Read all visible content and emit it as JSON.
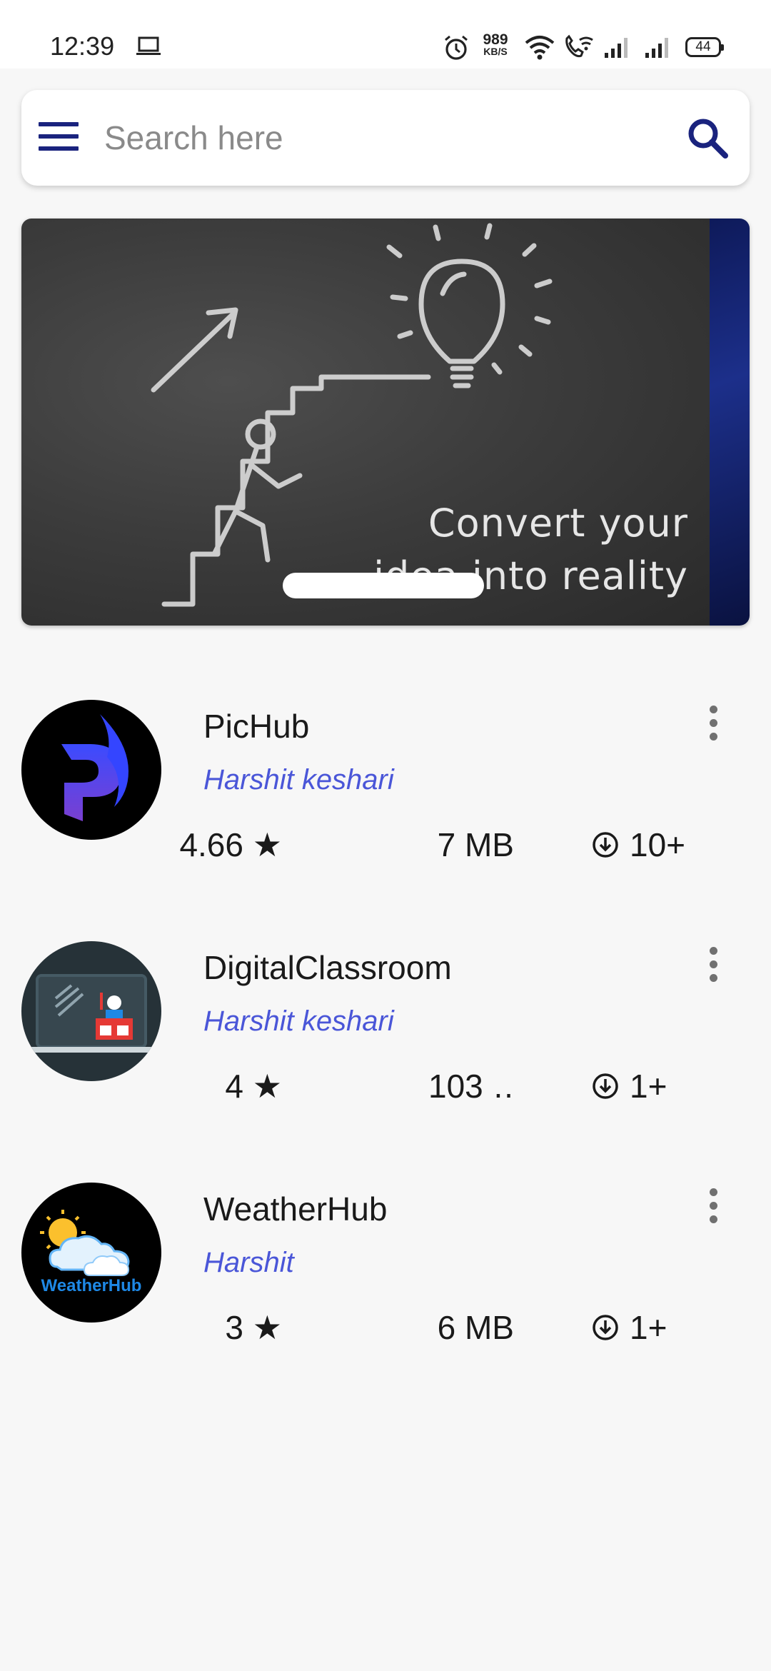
{
  "status_bar": {
    "time": "12:39",
    "net_speed_value": "989",
    "net_speed_unit": "KB/S",
    "battery_level": "44",
    "icons": [
      "laptop-icon",
      "alarm-icon",
      "wifi-icon",
      "wifi-calling-icon",
      "signal-icon",
      "signal-icon",
      "battery-icon"
    ]
  },
  "search": {
    "placeholder": "Search here",
    "value": ""
  },
  "banner": {
    "line1": "Convert your",
    "line2": "idea into reality"
  },
  "apps": [
    {
      "name": "PicHub",
      "author": "Harshit keshari",
      "rating": "4.66 ★",
      "size": "7 MB",
      "downloads": "10+"
    },
    {
      "name": "DigitalClassroom",
      "author": "Harshit keshari",
      "rating": "4 ★",
      "size": "103 …",
      "downloads": "1+"
    },
    {
      "name": "WeatherHub",
      "author": "Harshit",
      "rating": "3 ★",
      "size": "6 MB",
      "downloads": "1+",
      "logo_text": "WeatherHub"
    }
  ],
  "colors": {
    "accent": "#1a237e",
    "author_link": "#4a56d8",
    "background": "#f7f7f7"
  }
}
